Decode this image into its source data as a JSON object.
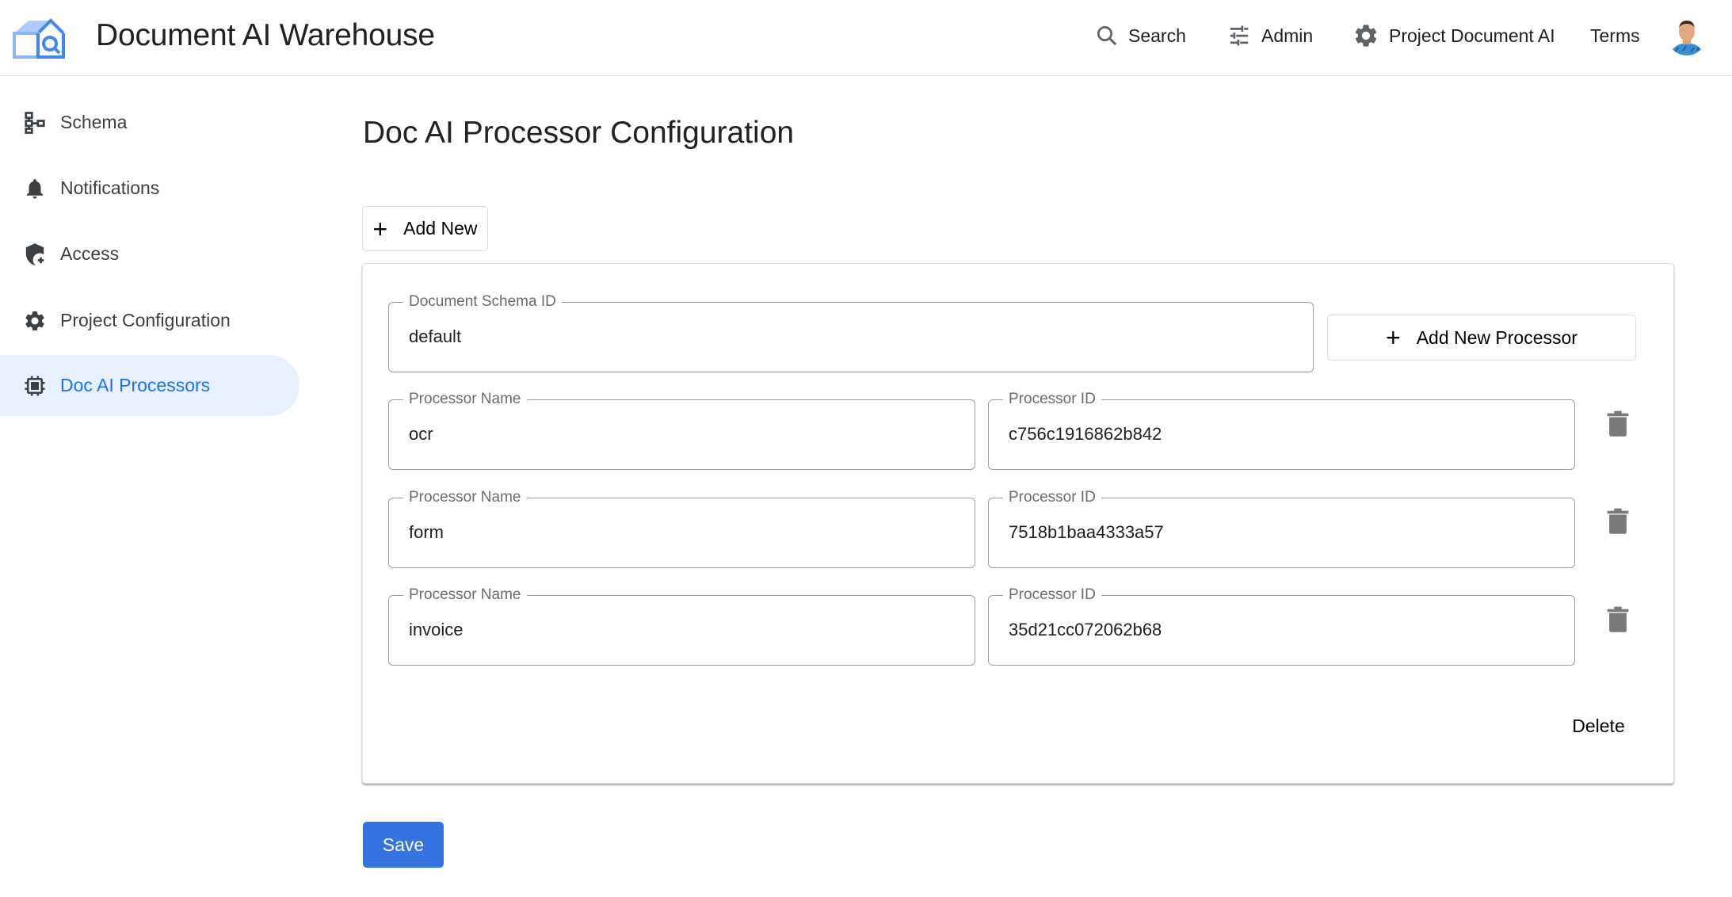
{
  "header": {
    "app_title": "Document AI Warehouse",
    "nav": [
      {
        "label": "Search",
        "icon": "search-icon"
      },
      {
        "label": "Admin",
        "icon": "tune-icon"
      },
      {
        "label": "Project Document AI",
        "icon": "gear-icon"
      },
      {
        "label": "Terms"
      }
    ],
    "brand_color": "#4285f4"
  },
  "sidebar": {
    "items": [
      {
        "label": "Schema",
        "icon": "schema-icon",
        "active": false
      },
      {
        "label": "Notifications",
        "icon": "bell-icon",
        "active": false
      },
      {
        "label": "Access",
        "icon": "shield-add-icon",
        "active": false
      },
      {
        "label": "Project Configuration",
        "icon": "gear-icon",
        "active": false
      },
      {
        "label": "Doc AI Processors",
        "icon": "chip-icon",
        "active": true
      }
    ],
    "active_color": "#1a73e8",
    "active_bg": "#e8f0fe"
  },
  "main": {
    "title": "Doc AI Processor Configuration",
    "add_new_label": "Add New",
    "card": {
      "schema_field": {
        "label": "Document Schema ID",
        "value": "default"
      },
      "add_processor_label": "Add New Processor",
      "processors": [
        {
          "name_label": "Processor Name",
          "name": "ocr",
          "id_label": "Processor ID",
          "id": "c756c1916862b842"
        },
        {
          "name_label": "Processor Name",
          "name": "form",
          "id_label": "Processor ID",
          "id": "7518b1baa4333a57"
        },
        {
          "name_label": "Processor Name",
          "name": "invoice",
          "id_label": "Processor ID",
          "id": "35d21cc072062b68"
        }
      ],
      "delete_label": "Delete"
    },
    "save_label": "Save",
    "save_color": "#3574e0"
  }
}
